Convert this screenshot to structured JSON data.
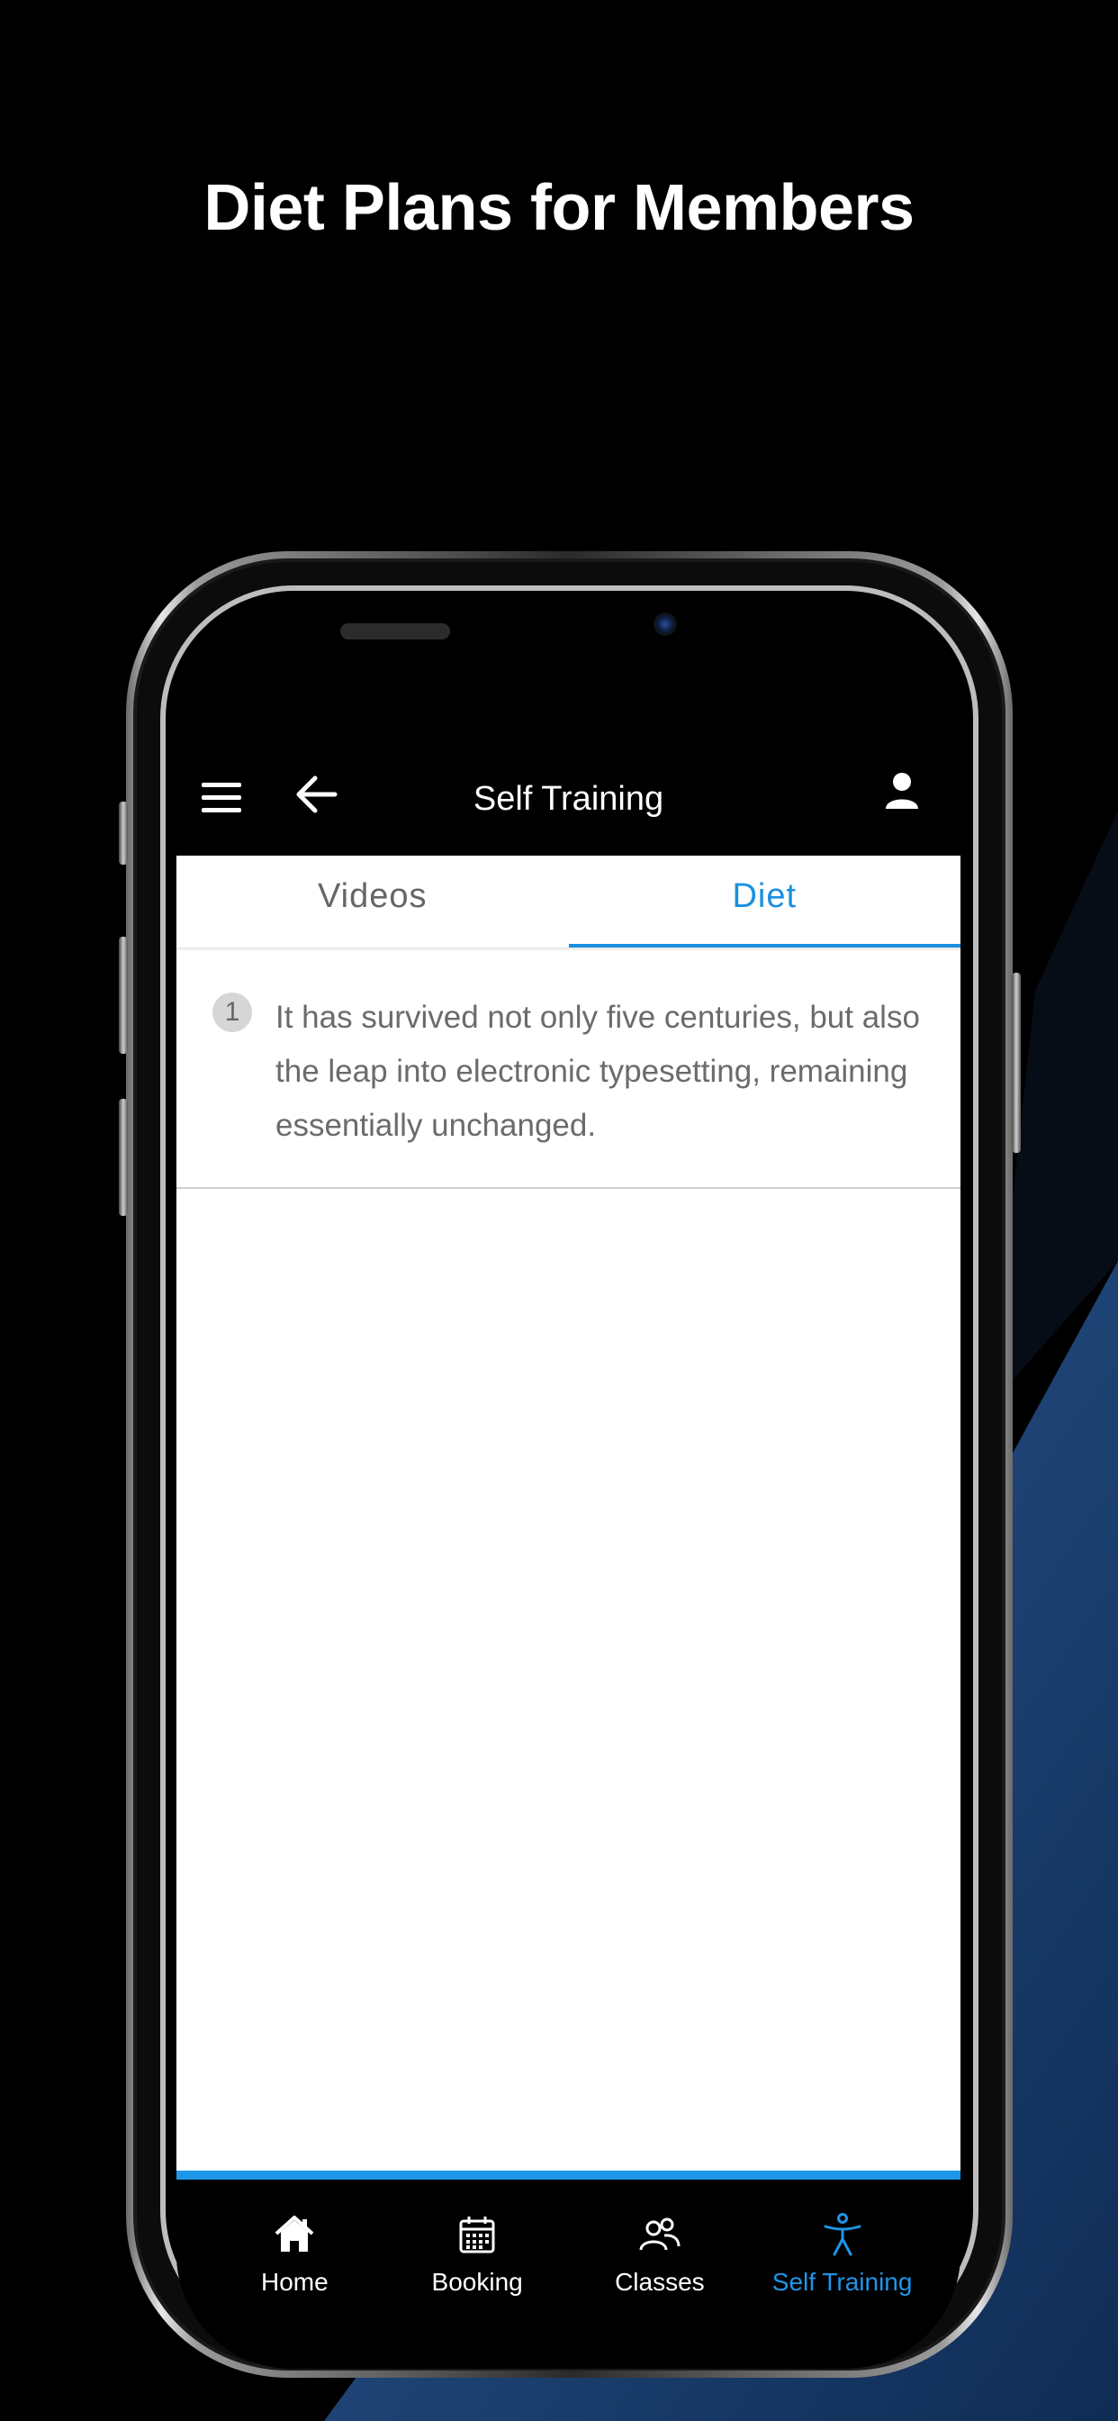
{
  "headline": "Diet Plans for Members",
  "header": {
    "title": "Self Training"
  },
  "tabs": [
    {
      "label": "Videos",
      "active": false
    },
    {
      "label": "Diet",
      "active": true
    }
  ],
  "diet_items": [
    {
      "number": "1",
      "text": "It has survived not only five centuries, but also the leap into electronic typesetting, remaining essentially unchanged."
    }
  ],
  "bottom_nav": [
    {
      "label": "Home",
      "icon": "home-icon",
      "active": false
    },
    {
      "label": "Booking",
      "icon": "calendar-icon",
      "active": false
    },
    {
      "label": "Classes",
      "icon": "users-icon",
      "active": false
    },
    {
      "label": "Self Training",
      "icon": "accessibility-icon",
      "active": true
    }
  ],
  "colors": {
    "accent": "#1e96e8",
    "background": "#000000",
    "content_bg": "#ffffff"
  }
}
